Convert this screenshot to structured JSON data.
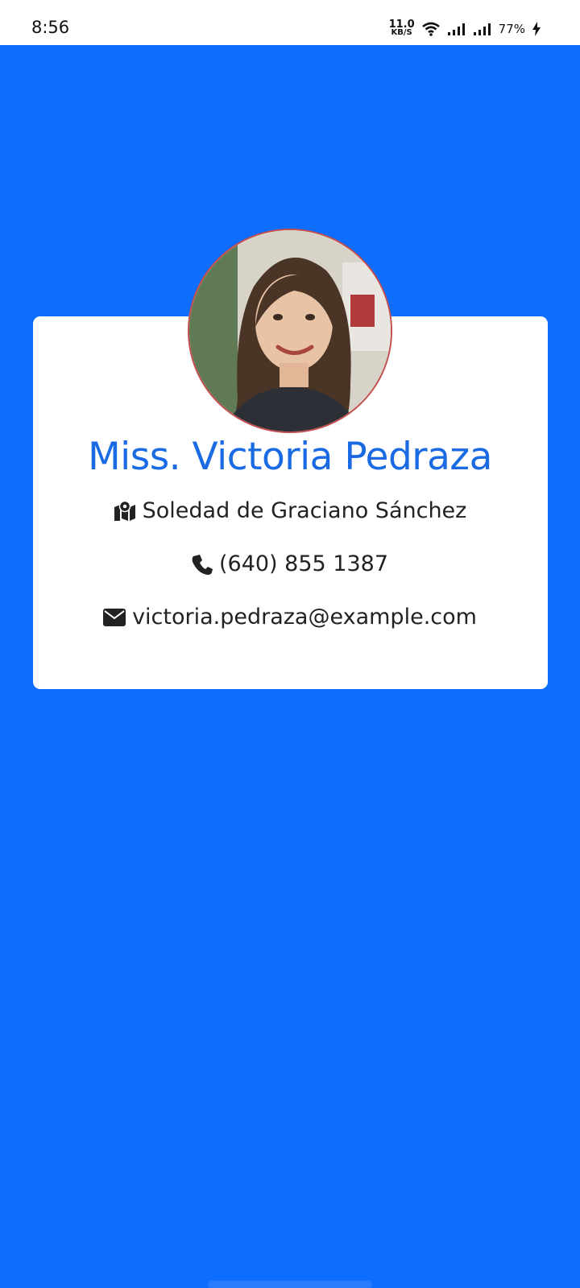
{
  "status_bar": {
    "time": "8:56",
    "net_speed_value": "11.0",
    "net_speed_unit": "KB/S",
    "battery": "77%"
  },
  "profile": {
    "name": "Miss. Victoria Pedraza",
    "location": "Soledad de Graciano Sánchez",
    "phone": "(640) 855 1387",
    "email": "victoria.pedraza@example.com"
  },
  "icons": {
    "location": "map-location-icon",
    "phone": "phone-icon",
    "email": "envelope-icon"
  },
  "colors": {
    "background": "#0d6efd",
    "name": "#1a6be3",
    "card": "#ffffff"
  }
}
